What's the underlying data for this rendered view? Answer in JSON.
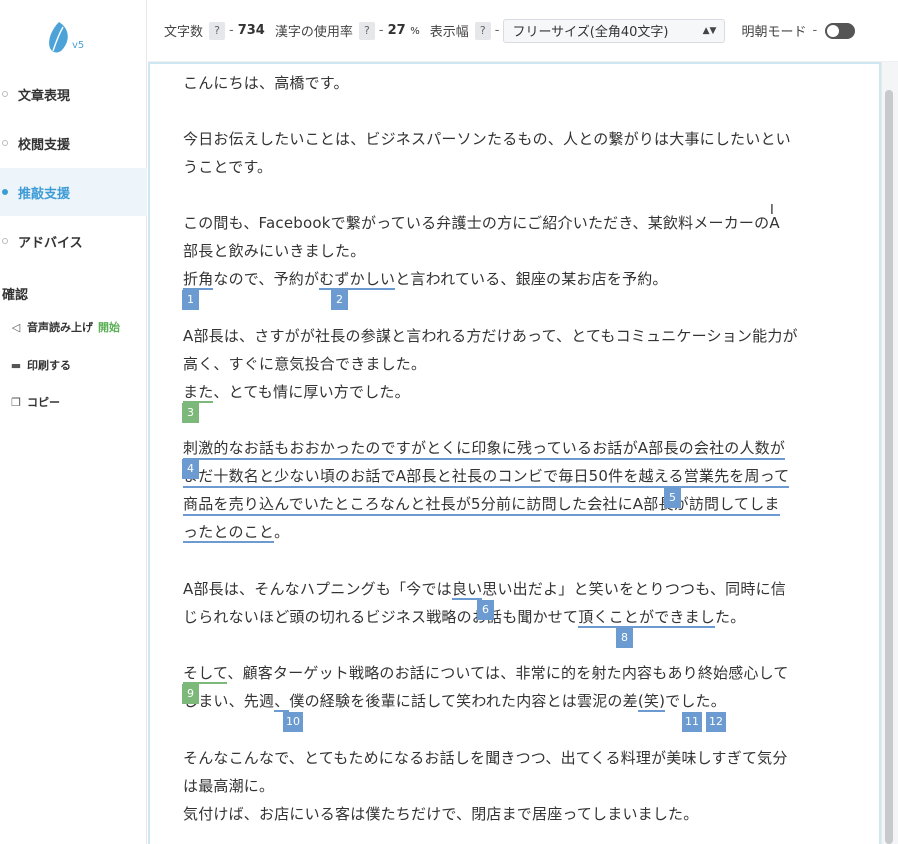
{
  "app": {
    "version": "v5"
  },
  "sidebar": {
    "nav": [
      {
        "label": "文章表現"
      },
      {
        "label": "校閲支援"
      },
      {
        "label": "推敲支援"
      },
      {
        "label": "アドバイス"
      }
    ],
    "section_title": "確認",
    "tools": [
      {
        "label": "音声読み上げ",
        "extra": "開始",
        "icon": "speaker-icon"
      },
      {
        "label": "印刷する",
        "icon": "printer-icon"
      },
      {
        "label": "コピー",
        "icon": "copy-icon"
      }
    ]
  },
  "topbar": {
    "char_count_label": "文字数",
    "char_count_value": "734",
    "kanji_label": "漢字の使用率",
    "kanji_value": "27",
    "kanji_unit": "%",
    "width_label": "表示幅",
    "width_select": "フリーサイズ(全角40文字)",
    "mincho_label": "明朝モード",
    "help": "?",
    "dash": "-"
  },
  "editor": {
    "lines": {
      "l1": "こんにちは、高橋です。",
      "l2": "今日お伝えしたいことは、ビジネスパーソンたるもの、人との繋がりは大事にしたいとい",
      "l3": "うことです。",
      "l4": "この間も、Facebookで繋がっている弁護士の方にご紹介いただき、某飲料メーカーのA",
      "l5": "部長と飲みにいきました。",
      "l6a": "折角",
      "l6b": "なので、予約が",
      "l6c": "むずかしい",
      "l6d": "と言われている、銀座の某お店を予約。",
      "l7": "A部長は、さすがが社長の参謀と言われる方だけあって、とてもコミュニケーション能力が",
      "l8": "高く、すぐに意気投合できました。",
      "l9a": "また",
      "l9b": "、とても情に厚い方でした。",
      "l10": "刺激的なお話もおおかったのですがとくに印象に残っているお話がA部長の会社の人数が",
      "l11": "まだ十数名と少ない頃のお話でA部長と社長のコンビで毎日50件を越える営業先を周って",
      "l12": "商品を売り込んでいたところなんと社長が5分前に訪問した会社にA部長が訪問してしま",
      "l13a": "ったとのこと",
      "l13b": "。",
      "l14a": "A部長は、そんなハプニングも「今では",
      "l14b": "良い",
      "l14c": "思い出だよ」と笑いをとりつつも、同時に信",
      "l15a": "じられないほど頭の切れるビジネス戦略のお話も聞かせて",
      "l15b": "頂くことができまし",
      "l15c": "た。",
      "l16a": "そして",
      "l16b": "、顧客ターゲット戦略のお話については、非常に的を射た内容もあり終始感心して",
      "l17a": "しまい、先週",
      "l17b": "、",
      "l17c": "僕の経験を後輩に話して笑われた内容とは雲泥の差",
      "l17d": "(笑)",
      "l17e": "でした。",
      "l18": "そんなこんなで、とてもためになるお話しを聞きつつ、出てくる料理が美味しすぎて気分",
      "l19": "は最高潮に。",
      "l20": "気付けば、お店にいる客は僕たちだけで、閉店まで居座ってしまいました。"
    },
    "badges": [
      "1",
      "2",
      "3",
      "4",
      "5",
      "6",
      "8",
      "9",
      "10",
      "11",
      "12"
    ]
  },
  "colors": {
    "accent": "#3d9bd6",
    "blue_mark": "#6b9bd1",
    "green_mark": "#7cb87a"
  }
}
